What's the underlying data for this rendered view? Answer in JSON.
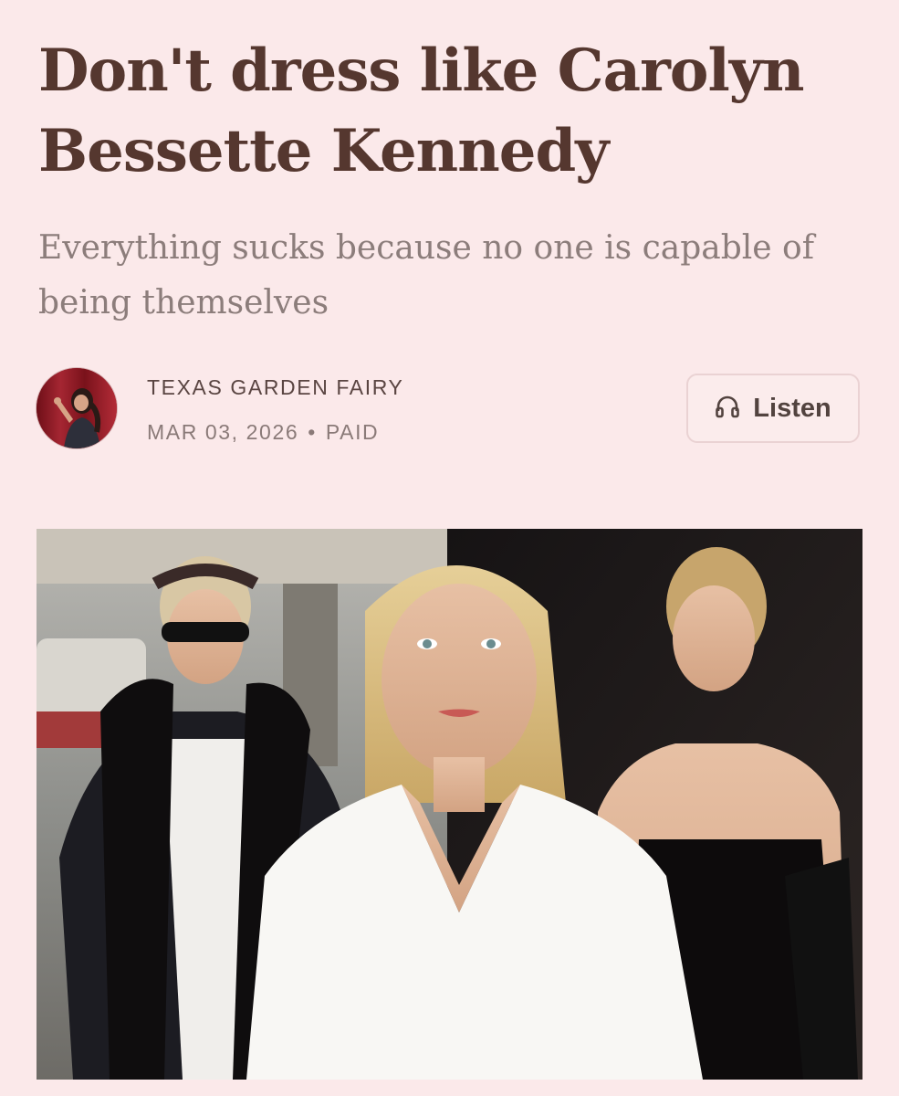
{
  "article": {
    "title": "Don't dress like Carolyn Bessette Kennedy",
    "subtitle": "Everything sucks because no one is capable of being themselves"
  },
  "byline": {
    "author": "TEXAS GARDEN FAIRY",
    "date": "MAR 03, 2026",
    "separator": "•",
    "access": "PAID",
    "avatar_icon": "author-avatar"
  },
  "actions": {
    "listen_label": "Listen",
    "listen_icon": "headphones-icon"
  },
  "colors": {
    "background": "#fbe9ea",
    "title": "#55372f",
    "subtitle": "#8c7d7b",
    "meta": "#8a7a78"
  }
}
